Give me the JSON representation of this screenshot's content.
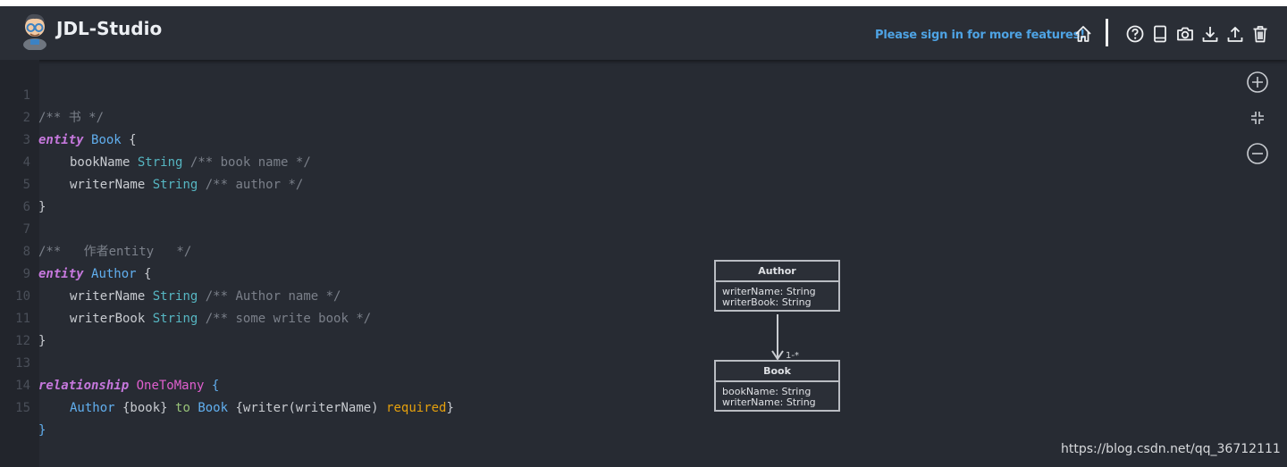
{
  "header": {
    "brand": "JDL-Studio",
    "signin_text": "Please sign in for more features!",
    "icons": [
      "home-icon",
      "help-icon",
      "book-icon",
      "camera-icon",
      "download-icon",
      "upload-icon",
      "trash-icon"
    ]
  },
  "editor": {
    "line_numbers": [
      "1",
      "2",
      "3",
      "4",
      "5",
      "6",
      "7",
      "8",
      "9",
      "10",
      "11",
      "12",
      "13",
      "14",
      "15"
    ],
    "l1": {
      "comment": "/** 书 */"
    },
    "l2": {
      "kw": "entity",
      "name": "Book",
      "brace": " {"
    },
    "l3": {
      "field": "bookName",
      "type": "String",
      "comment": "/** book name */"
    },
    "l4": {
      "field": "writerName",
      "type": "String",
      "comment": "/** author */"
    },
    "l5": {
      "brace": "}"
    },
    "l7": {
      "comment": "/**   作者entity   */"
    },
    "l8": {
      "kw": "entity",
      "name": "Author",
      "brace": " {"
    },
    "l9": {
      "field": "writerName",
      "type": "String",
      "comment": "/** Author name */"
    },
    "l10": {
      "field": "writerBook",
      "type": "String",
      "comment": "/** some write book */"
    },
    "l11": {
      "brace": "}"
    },
    "l13": {
      "kw": "relationship",
      "rel": "OneToMany",
      "brace": " {"
    },
    "l14": {
      "from": "Author",
      "from_field": " {book} ",
      "to": "to",
      "to_entity": "Book",
      "to_field": " {writer(writerName) ",
      "required": "required",
      "close": "}"
    },
    "l15": {
      "brace": "}"
    }
  },
  "right_tools": [
    "zoom-in-icon",
    "fit-icon",
    "zoom-out-icon"
  ],
  "diagram": {
    "author": {
      "title": "Author",
      "fields": [
        "writerName: String",
        "writerBook: String"
      ]
    },
    "book": {
      "title": "Book",
      "fields": [
        "bookName: String",
        "writerName: String"
      ]
    },
    "multiplicity": "1-*"
  },
  "watermark": "https://blog.csdn.net/qq_36712111",
  "colors": {
    "background": "#272b33",
    "accent": "#4ea3e4",
    "keyword": "#c678dd",
    "entity": "#61afef",
    "type": "#56b6c2",
    "relationship": "#e05fcf",
    "required": "#e5a00d"
  }
}
